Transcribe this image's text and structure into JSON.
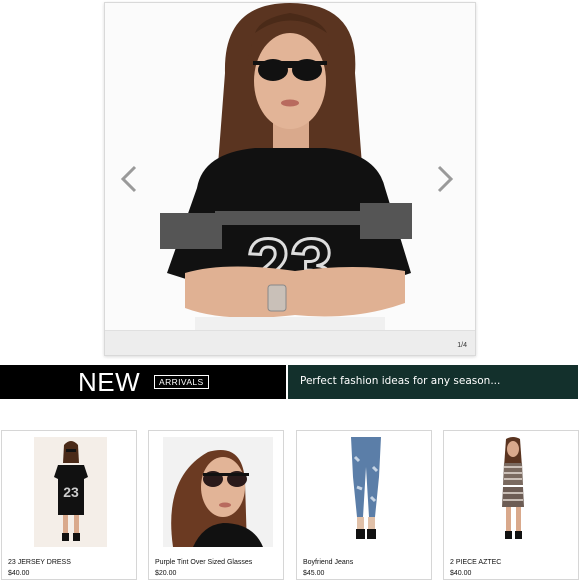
{
  "hero": {
    "counter": "1/4",
    "prev_icon": "chevron-left-icon",
    "next_icon": "chevron-right-icon"
  },
  "banner": {
    "new_label": "NEW",
    "arrivals_label": "ARRIVALS",
    "tagline": "Perfect fashion ideas for any season...",
    "left_color": "#000000",
    "right_color": "#13302c"
  },
  "products": [
    {
      "name": "23 JERSEY DRESS",
      "price": "$40.00"
    },
    {
      "name": "Purple Tint Over Sized Glasses",
      "price": "$20.00"
    },
    {
      "name": "Boyfriend Jeans",
      "price": "$45.00"
    },
    {
      "name": "2 PIECE AZTEC",
      "price": "$40.00"
    }
  ]
}
